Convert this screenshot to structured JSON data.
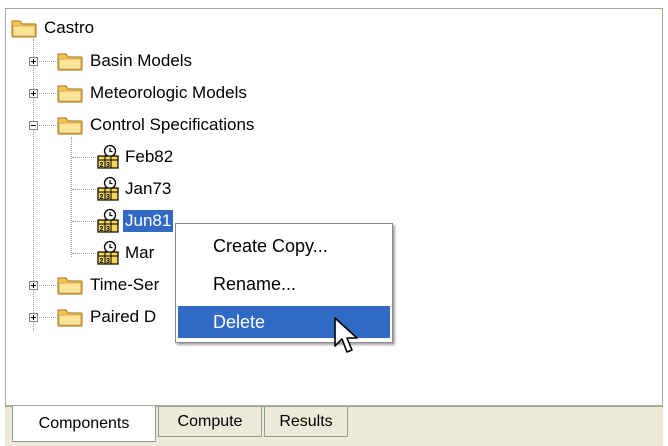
{
  "tree": {
    "root": "Castro",
    "basin_models": "Basin Models",
    "meteorologic_models": "Meteorologic Models",
    "control_specifications": "Control Specifications",
    "specs": [
      "Feb82",
      "Jan73",
      "Jun81",
      "Mar"
    ],
    "time_series": "Time-Ser",
    "paired_data": "Paired D"
  },
  "context_menu": {
    "create_copy": "Create Copy...",
    "rename": "Rename...",
    "delete": "Delete"
  },
  "tabs": {
    "components": "Components",
    "compute": "Compute",
    "results": "Results"
  },
  "colors": {
    "selection": "#316ac5",
    "folder_fill": "#f7d26b",
    "tab_background": "#ece9d8"
  }
}
